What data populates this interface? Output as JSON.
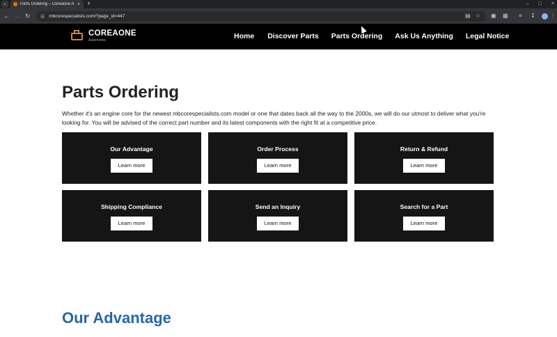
{
  "browser": {
    "tab_title": "Parts Ordering – Coreaone A…",
    "tab_close": "×",
    "new_tab": "+",
    "url": "mbcorespecialists.com/?page_id=447",
    "menu_icon": "chevron-down-icon",
    "window_controls": [
      "–",
      "□",
      "×"
    ]
  },
  "site": {
    "logo_name": "COREAONE",
    "logo_sub": "Automotive",
    "nav": [
      "Home",
      "Discover Parts",
      "Parts Ordering",
      "Ask Us Anything",
      "Legal Notice"
    ]
  },
  "main": {
    "title": "Parts Ordering",
    "intro": "Whether it's an engine core for the newest mbcorespecialists.com model or one that dates back all the way to the 2000s, we will do our utmost to deliver what you're looking for. You will be advised of the correct part number and its latest components with the right fit at a competitive price.",
    "cards": [
      {
        "title": "Our Advantage",
        "button": "Learn more"
      },
      {
        "title": "Order Process",
        "button": "Learn more"
      },
      {
        "title": "Return & Refund",
        "button": "Learn more"
      },
      {
        "title": "Shipping Compliance",
        "button": "Learn more"
      },
      {
        "title": "Send an Inquiry",
        "button": "Learn more"
      },
      {
        "title": "Search for a Part",
        "button": "Learn more"
      }
    ],
    "section_title": "Our Advantage"
  },
  "colors": {
    "header_bg": "#000000",
    "card_bg": "#151515",
    "section_title": "#2667a8",
    "logo_accent": "#c8883c"
  }
}
